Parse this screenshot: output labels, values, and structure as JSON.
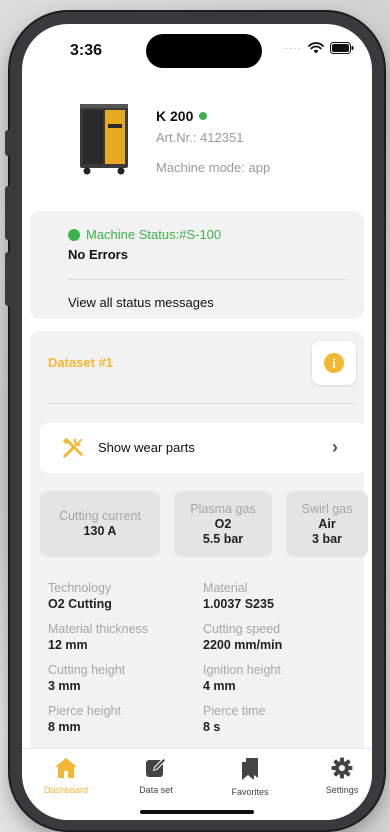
{
  "status_bar": {
    "time": "3:36"
  },
  "machine": {
    "name": "K 200",
    "art_nr": "Art.Nr.: 412351",
    "mode": "Machine mode: app"
  },
  "status": {
    "title": "Machine Status:#S-100",
    "errors": "No Errors",
    "view_all": "View all status messages"
  },
  "dataset": {
    "title": "Dataset #1",
    "wear_parts_label": "Show wear parts",
    "params": [
      {
        "label": "Cutting current",
        "value": "130 A"
      },
      {
        "label": "Plasma gas",
        "value": "O2",
        "value2": "5.5 bar"
      },
      {
        "label": "Swirl gas",
        "value": "Air",
        "value2": "3 bar"
      }
    ],
    "details": [
      {
        "label": "Technology",
        "value": "O2 Cutting"
      },
      {
        "label": "Material",
        "value": "1.0037 S235"
      },
      {
        "label": "Material thickness",
        "value": "12 mm"
      },
      {
        "label": "Cutting speed",
        "value": "2200 mm/min"
      },
      {
        "label": "Cutting height",
        "value": "3 mm"
      },
      {
        "label": "Ignition height",
        "value": "4 mm"
      },
      {
        "label": "Pierce height",
        "value": "8 mm"
      },
      {
        "label": "Pierce time",
        "value": "8 s"
      }
    ]
  },
  "tabs": [
    {
      "label": "Dashboard",
      "icon": "home-icon",
      "active": true
    },
    {
      "label": "Data set",
      "icon": "edit-icon",
      "active": false
    },
    {
      "label": "Favorites",
      "icon": "bookmark-icon",
      "active": false
    },
    {
      "label": "Settings",
      "icon": "gear-icon",
      "active": false
    }
  ],
  "colors": {
    "accent": "#f4b731",
    "status_green": "#3cb34a"
  }
}
